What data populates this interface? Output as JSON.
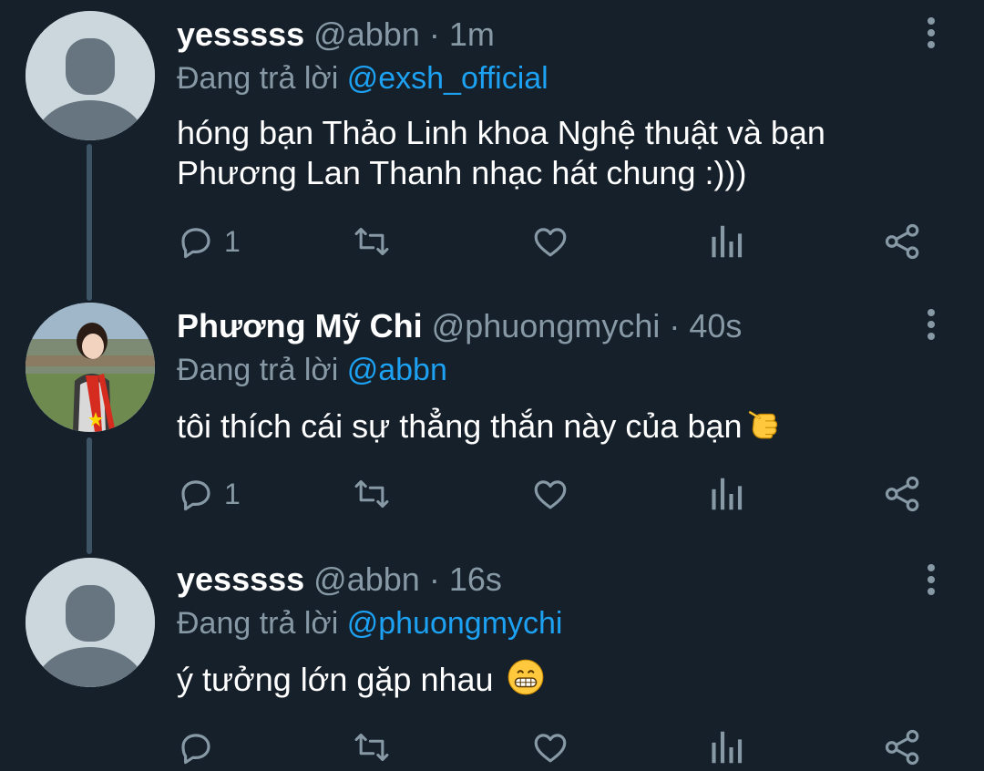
{
  "tweets": [
    {
      "display_name": "yesssss",
      "handle": "@abbn",
      "separator": "·",
      "time": "1m",
      "reply_prefix": "Đang trả lời",
      "reply_to": "@exsh_official",
      "text_line1": "hóng bạn Thảo Linh khoa Nghệ thuật và bạn",
      "text_line2": "Phương Lan Thanh nhạc hát chung :)))",
      "reply_count": "1",
      "avatar": "default-avatar-icon"
    },
    {
      "display_name": "Phương Mỹ Chi",
      "handle": "@phuongmychi",
      "separator": "·",
      "time": "40s",
      "reply_prefix": "Đang trả lời",
      "reply_to": "@abbn",
      "text": "tôi thích cái sự thẳng thắn này của bạn",
      "emoji": "pointing-hand-emoji",
      "reply_count": "1",
      "avatar": "profile-photo"
    },
    {
      "display_name": "yesssss",
      "handle": "@abbn",
      "separator": "·",
      "time": "16s",
      "reply_prefix": "Đang trả lời",
      "reply_to": "@phuongmychi",
      "text": "ý tưởng lớn gặp nhau",
      "emoji": "grinning-face-emoji",
      "reply_count": "",
      "avatar": "default-avatar-icon"
    }
  ],
  "icons": {
    "reply": "reply-icon",
    "retweet": "retweet-icon",
    "like": "heart-icon",
    "analytics": "analytics-icon",
    "share": "share-icon",
    "more": "more-vertical-icon"
  },
  "colors": {
    "background": "#15202b",
    "text": "#ffffff",
    "secondary": "#8899a6",
    "link": "#1da1f2",
    "thread_line": "#3d5466"
  }
}
